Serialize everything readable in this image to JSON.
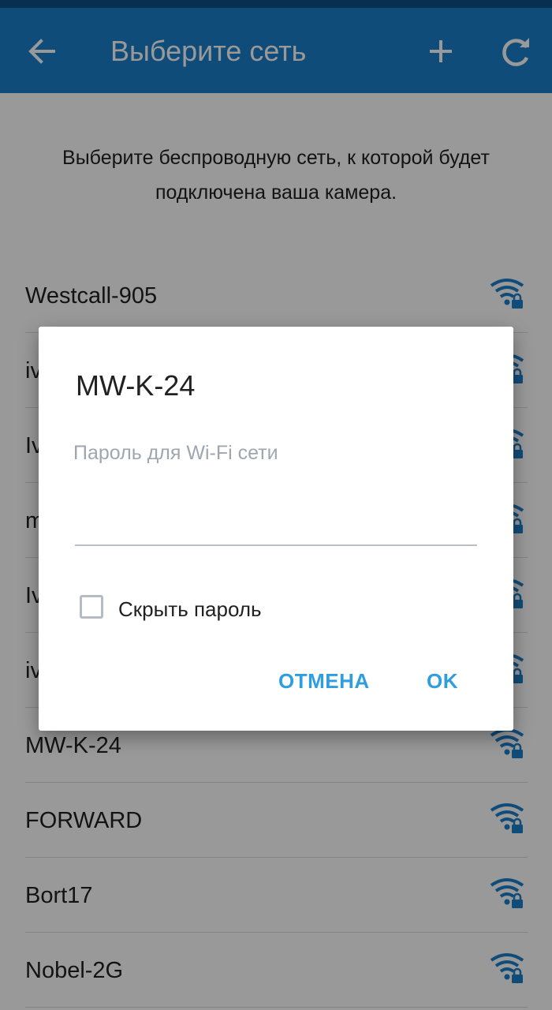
{
  "app_bar": {
    "title": "Выберите сеть",
    "icons": [
      "arrow-back-icon",
      "plus-icon",
      "refresh-icon"
    ],
    "color": "#1b7fcc"
  },
  "intro_text": "Выберите беспроводную сеть, к которой будет подключена ваша камера.",
  "networks": [
    {
      "name": "Westcall-905"
    },
    {
      "name": "iv"
    },
    {
      "name": "Iv"
    },
    {
      "name": "m"
    },
    {
      "name": "Iv"
    },
    {
      "name": "iv"
    },
    {
      "name": "MW-K-24"
    },
    {
      "name": "FORWARD"
    },
    {
      "name": "Bort17"
    },
    {
      "name": "Nobel-2G"
    }
  ],
  "network_icon": "wifi-lock-icon",
  "dialog": {
    "title": "MW-K-24",
    "password_placeholder": "Пароль для Wi-Fi сети",
    "password_value": "",
    "hide_password_label": "Скрыть пароль",
    "hide_password_checked": false,
    "cancel_label": "ОТМЕНА",
    "ok_label": "OK",
    "accent_color": "#2f9ee0"
  }
}
